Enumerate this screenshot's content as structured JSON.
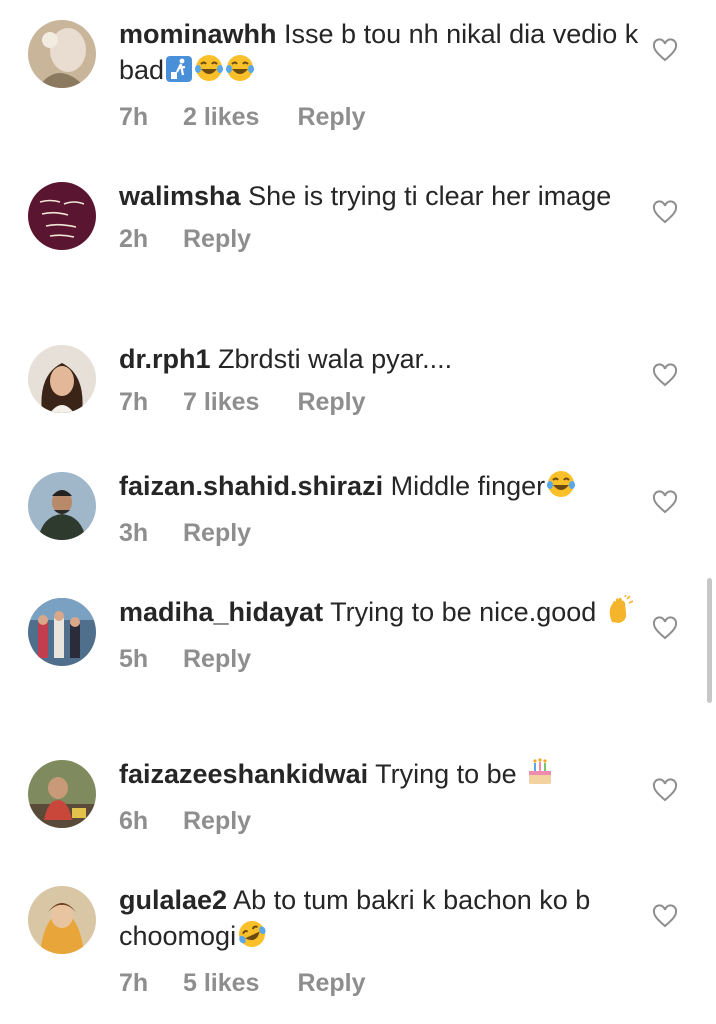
{
  "comments": [
    {
      "username": "mominawhh",
      "text": "Isse b tou nh nikal dia vedio k bad",
      "emojis": [
        "litter-bin-icon",
        "laughing-tears-icon",
        "laughing-tears-icon"
      ],
      "time": "7h",
      "likes": "2 likes",
      "reply": "Reply"
    },
    {
      "username": "walimsha",
      "text": "She is trying ti clear  her image",
      "emojis": [],
      "time": "2h",
      "likes": "",
      "reply": "Reply"
    },
    {
      "username": "dr.rph1",
      "text": "Zbrdsti wala pyar....",
      "emojis": [],
      "time": "7h",
      "likes": "7 likes",
      "reply": "Reply"
    },
    {
      "username": "faizan.shahid.shirazi",
      "text": "Middle finger",
      "emojis": [
        "laughing-tears-icon"
      ],
      "time": "3h",
      "likes": "",
      "reply": "Reply"
    },
    {
      "username": "madiha_hidayat",
      "text": "Trying to be nice.good",
      "emojis": [
        "clapping-hand-icon"
      ],
      "time": "5h",
      "likes": "",
      "reply": "Reply"
    },
    {
      "username": "faizazeeshankidwai",
      "text": "Trying to be",
      "emojis": [
        "birthday-cake-icon"
      ],
      "time": "6h",
      "likes": "",
      "reply": "Reply"
    },
    {
      "username": "gulalae2",
      "text": "Ab to tum bakri k bachon ko b choomogi",
      "emojis": [
        "rolling-laughing-icon"
      ],
      "time": "7h",
      "likes": "5 likes",
      "reply": "Reply"
    }
  ],
  "colors": {
    "text": "#262626",
    "meta": "#8e8e8e",
    "heart": "#8e8e8e",
    "emoji_face": "#f9c02a"
  }
}
